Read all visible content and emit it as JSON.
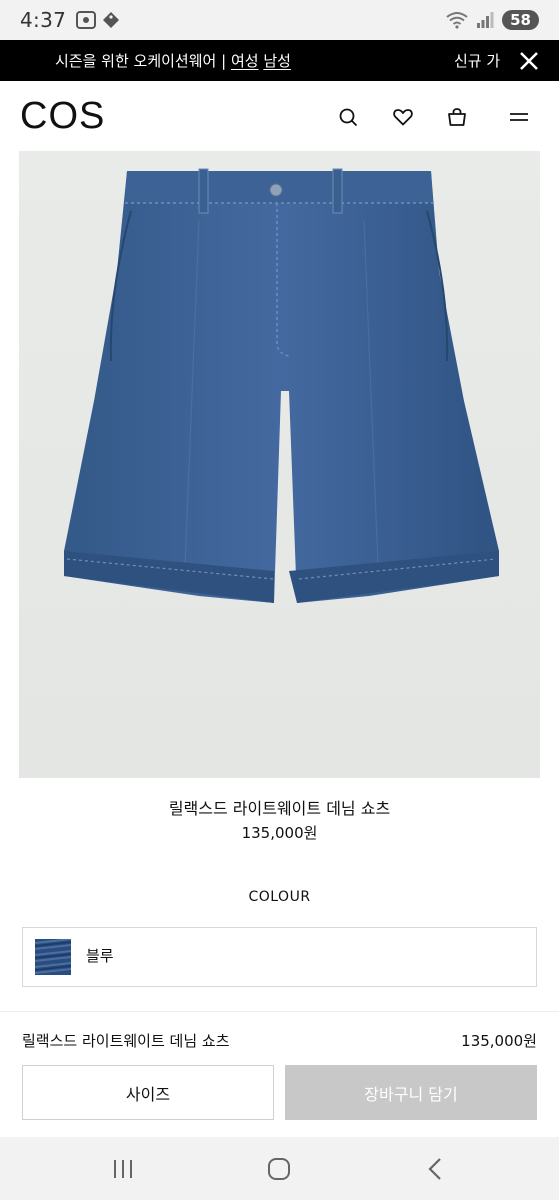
{
  "status_bar": {
    "time": "4:37",
    "battery": "58"
  },
  "promo": {
    "text": "시즌을 위한 오케이션웨어 | ",
    "link_women": "여성",
    "link_men": "남성",
    "new_label": "신규 가"
  },
  "header": {
    "logo": "COS"
  },
  "product": {
    "name": "릴랙스드 라이트웨이트 데님 쇼츠",
    "price": "135,000원",
    "colour_label": "COLOUR",
    "colour_name": "블루"
  },
  "bottom_bar": {
    "product_name": "릴랙스드 라이트웨이트 데님 쇼츠",
    "price": "135,000원",
    "size_button": "사이즈",
    "add_to_bag_button": "장바구니 담기"
  },
  "icons": {
    "close": "close-icon",
    "search": "search-icon",
    "wishlist": "heart-icon",
    "bag": "bag-icon",
    "menu": "menu-icon"
  },
  "colors": {
    "promo_bg": "#000000",
    "disabled_button": "#c8c8c8",
    "denim": "#3a5f8f"
  }
}
